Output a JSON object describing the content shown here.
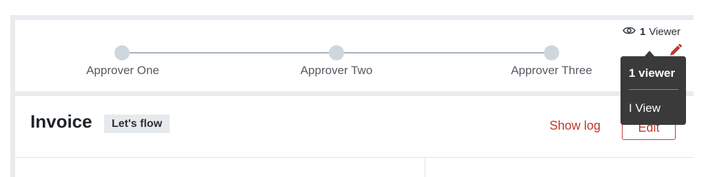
{
  "approval_flow": {
    "steps": [
      {
        "label": "Approver One"
      },
      {
        "label": "Approver Two"
      },
      {
        "label": "Approver Three"
      }
    ]
  },
  "viewers": {
    "count": "1",
    "label": "Viewer",
    "icon": "eye-icon"
  },
  "tooltip": {
    "title": "1 viewer",
    "items": [
      "I View"
    ]
  },
  "invoice": {
    "title": "Invoice",
    "status_badge": "Let's flow",
    "show_log_label": "Show log",
    "edit_label": "Edit"
  },
  "colors": {
    "accent": "#c0392b",
    "step_dot": "#d0d6dd",
    "track": "#a9b3be",
    "tooltip_bg": "#3a3a3a"
  }
}
